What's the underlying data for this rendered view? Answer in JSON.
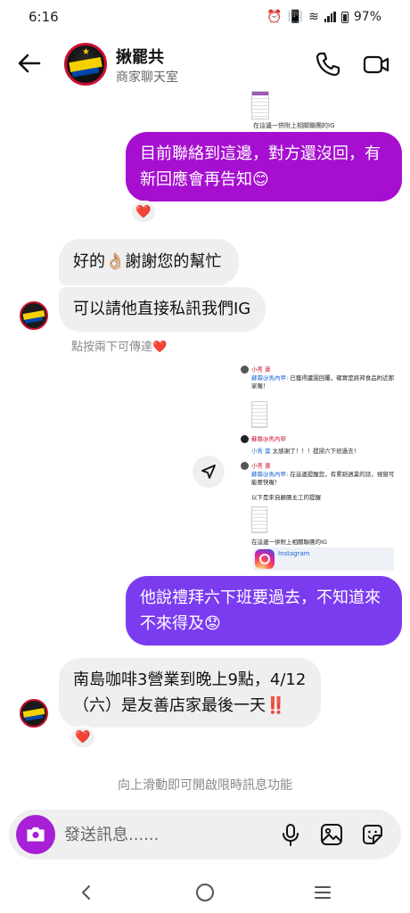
{
  "status_bar": {
    "time": "6:16",
    "battery": "97%"
  },
  "header": {
    "title": "揪罷共",
    "subtitle": "商家聊天室"
  },
  "top_image_caption": "在這邊一併附上相關聯團的IG",
  "messages": {
    "m1": "目前聯絡到這邊，對方還沒回，有新回應會再告知😊",
    "m2": "好的👌🏼謝謝您的幫忙",
    "m3": "可以請他直接私訊我們IG",
    "m3_hint": "點按兩下可傳達❤️",
    "m4": "他說禮拜六下班要過去，不知道來不來得及😟",
    "m5": "南島咖啡3營業到晚上9點，4/12（六）是友善店家最後一天‼️"
  },
  "reaction": "❤️",
  "shared_image": {
    "line1_name": "小秀 葉",
    "line1_text_link": "蘇霖@馬內甲",
    "line1_text": ": 已獲得蘆園回覆，確實是將邦食品附近那家喔！",
    "line2_name": "蘇霖@馬內甲",
    "line2_text_link": "小秀 葉",
    "line2_text": " 太感謝了！！！提掃六下班過去！",
    "line3_name": "小秀 葉",
    "line3_text_link": "蘇霖@馬內甲",
    "line3_text": ": 在這邊提醒您，有累蹈週業的話，視窗可能要快喔！",
    "line3_text2": "以下是來自顧團主工的提醒",
    "caption": "在這邊一併附上相關聯團的IG",
    "ig_label": "Instagram"
  },
  "footer_hint": "向上滑動即可開啟限時訊息功能",
  "composer": {
    "placeholder": "發送訊息......"
  }
}
